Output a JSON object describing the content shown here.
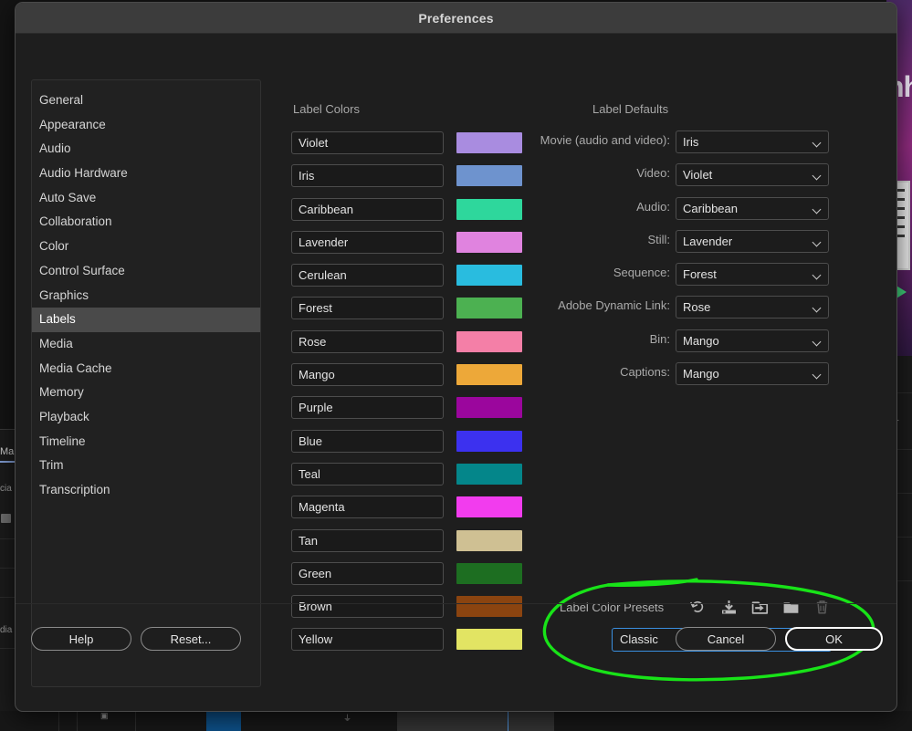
{
  "window": {
    "title": "Preferences"
  },
  "sidebar": {
    "items": [
      {
        "label": "General"
      },
      {
        "label": "Appearance"
      },
      {
        "label": "Audio"
      },
      {
        "label": "Audio Hardware"
      },
      {
        "label": "Auto Save"
      },
      {
        "label": "Collaboration"
      },
      {
        "label": "Color"
      },
      {
        "label": "Control Surface"
      },
      {
        "label": "Graphics"
      },
      {
        "label": "Labels"
      },
      {
        "label": "Media"
      },
      {
        "label": "Media Cache"
      },
      {
        "label": "Memory"
      },
      {
        "label": "Playback"
      },
      {
        "label": "Timeline"
      },
      {
        "label": "Trim"
      },
      {
        "label": "Transcription"
      }
    ],
    "selected_index": 9
  },
  "label_colors": {
    "heading": "Label Colors",
    "rows": [
      {
        "name": "Violet",
        "color": "#a98ce0"
      },
      {
        "name": "Iris",
        "color": "#6e93ce"
      },
      {
        "name": "Caribbean",
        "color": "#2ed79c"
      },
      {
        "name": "Lavender",
        "color": "#e083df"
      },
      {
        "name": "Cerulean",
        "color": "#29bcdf"
      },
      {
        "name": "Forest",
        "color": "#4cb151"
      },
      {
        "name": "Rose",
        "color": "#f47fa7"
      },
      {
        "name": "Mango",
        "color": "#eda839"
      },
      {
        "name": "Purple",
        "color": "#9b069d"
      },
      {
        "name": "Blue",
        "color": "#3c31ef"
      },
      {
        "name": "Teal",
        "color": "#04868a"
      },
      {
        "name": "Magenta",
        "color": "#f23cee"
      },
      {
        "name": "Tan",
        "color": "#cfc093"
      },
      {
        "name": "Green",
        "color": "#1d6e21"
      },
      {
        "name": "Brown",
        "color": "#8b4410"
      },
      {
        "name": "Yellow",
        "color": "#e2e463"
      }
    ]
  },
  "label_defaults": {
    "heading": "Label Defaults",
    "rows": [
      {
        "label": "Movie (audio and video):",
        "value": "Iris"
      },
      {
        "label": "Video:",
        "value": "Violet"
      },
      {
        "label": "Audio:",
        "value": "Caribbean"
      },
      {
        "label": "Still:",
        "value": "Lavender"
      },
      {
        "label": "Sequence:",
        "value": "Forest"
      },
      {
        "label": "Adobe Dynamic Link:",
        "value": "Rose"
      },
      {
        "label": "Bin:",
        "value": "Mango"
      },
      {
        "label": "Captions:",
        "value": "Mango"
      }
    ]
  },
  "presets": {
    "title": "Label Color Presets",
    "icons": [
      {
        "name": "reset-icon",
        "enabled": true
      },
      {
        "name": "import-icon",
        "enabled": true
      },
      {
        "name": "export-icon",
        "enabled": true
      },
      {
        "name": "folder-icon",
        "enabled": true
      },
      {
        "name": "trash-icon",
        "enabled": false
      }
    ],
    "selected_preset": "Classic"
  },
  "annotation": {
    "shape": "ellipse",
    "color": "#18e318"
  },
  "footer": {
    "help_label": "Help",
    "reset_label": "Reset...",
    "cancel_label": "Cancel",
    "ok_label": "OK"
  },
  "background": {
    "left_tab_text": "Mar",
    "left_rows": [
      "cia",
      "dia"
    ],
    "right_text": "nhi"
  }
}
